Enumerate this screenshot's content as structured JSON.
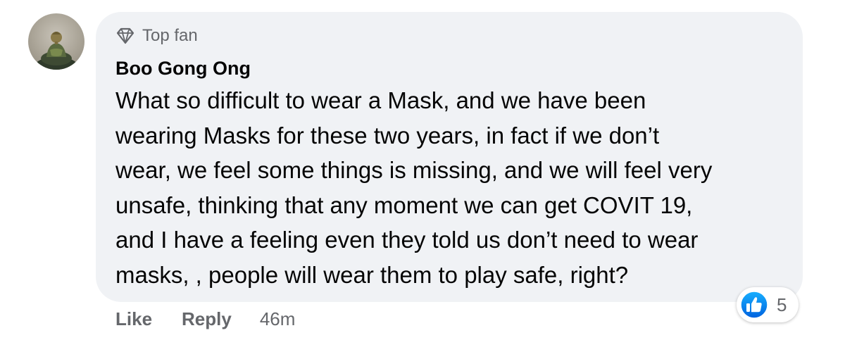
{
  "comment": {
    "badge_label": "Top fan",
    "badge_icon": "diamond-icon",
    "author": "Boo Gong Ong",
    "body_lines": [
      "What so difficult to wear a Mask, and we have been",
      "wearing Masks for these two years, in fact if we don’t",
      "wear, we feel some things is missing, and we will feel very",
      "unsafe, thinking that any moment we can get COVIT 19,",
      "and I have a feeling even they told us don’t need to wear",
      "masks, , people will wear them to play safe, right?"
    ],
    "actions": {
      "like_label": "Like",
      "reply_label": "Reply",
      "time": "46m"
    },
    "reactions": {
      "icon": "thumbs-up-icon",
      "count": "5"
    }
  },
  "colors": {
    "bubble_bg": "#f0f2f5",
    "meta_gray": "#65676b",
    "text": "#050505",
    "like_blue": "#1877f2"
  }
}
